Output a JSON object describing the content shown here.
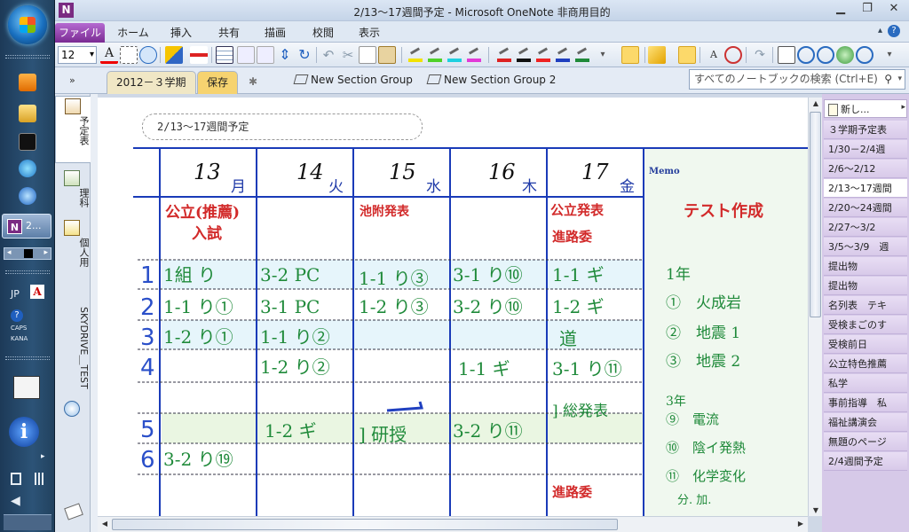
{
  "window": {
    "title": "2/13～17週間予定 - Microsoft OneNote 非商用目的",
    "app_letter": "N"
  },
  "taskbar": {
    "active_label": "2...",
    "lang": "JP",
    "caps": "CAPS",
    "kana": "KANA"
  },
  "ribbon_tabs": [
    "ファイル",
    "ホーム",
    "挿入",
    "共有",
    "描画",
    "校閲",
    "表示"
  ],
  "toolbar": {
    "font_size": "12"
  },
  "sections": {
    "notebook_arrow": "»",
    "tabs": [
      {
        "label": "2012－３学期"
      },
      {
        "label": "保存"
      }
    ],
    "groups": [
      "New Section Group",
      "New Section Group 2"
    ],
    "search_placeholder": "すべてのノートブックの検索 (Ctrl+E)"
  },
  "notebooks": [
    "予定表",
    "理科",
    "個人用",
    "SKYDRIVE＿TEST"
  ],
  "page": {
    "title": "2/13～17週間予定",
    "days": [
      {
        "num": "13",
        "name": "月"
      },
      {
        "num": "14",
        "name": "火"
      },
      {
        "num": "15",
        "name": "水"
      },
      {
        "num": "16",
        "name": "木"
      },
      {
        "num": "17",
        "name": "金"
      }
    ],
    "memo_label": "Memo",
    "row_numbers": [
      "1",
      "2",
      "3",
      "4",
      "5",
      "6"
    ],
    "events": {
      "mon": [
        "公立(推薦)",
        "入試"
      ],
      "wed": "池附発表",
      "fri": [
        "公立発表",
        "進路委"
      ]
    },
    "cells": {
      "mon": [
        "1組 り",
        "1-1 り①",
        "1-2 り①",
        "",
        "",
        "3-2 り⑲"
      ],
      "tue": [
        "3-2 PC",
        "3-1 PC",
        "1-1 り②",
        "1-2 り②",
        "1-2 ギ",
        ""
      ],
      "wed": [
        "1-1 り③",
        "1-2 り③",
        "",
        "",
        "] 研授",
        ""
      ],
      "thu": [
        "3-1 り⑩",
        "3-2 り⑩",
        "",
        "1-1 ギ",
        "3-2 り⑪",
        ""
      ],
      "fri": [
        "1-1 ギ",
        "1-2 ギ",
        "道",
        "3-1 り⑪",
        "] 総発表",
        ""
      ]
    },
    "bottom_note": "進路委",
    "memo": {
      "heading": "テスト作成",
      "lines": [
        "1年",
        "①　火成岩",
        "②　地震 1",
        "③　地震 2",
        "3年",
        "⑨　電流",
        "⑩　陰イ発熱",
        "⑪　化学変化",
        "　分. 加."
      ]
    }
  },
  "pagelist": {
    "new_label": "新し...",
    "items": [
      "３学期予定表",
      "1/30－2/4週",
      "2/6～2/12",
      "2/13～17週間",
      "2/20～24週間",
      "2/27～3/2",
      "3/5～3/9　週",
      "提出物",
      "提出物",
      "名列表　テキ",
      "受検まごのす",
      "受検前日",
      "公立特色推薦",
      "私学",
      "事前指導　私",
      "福祉講演会",
      "無題のページ",
      "2/4週間予定"
    ]
  },
  "colors": {
    "grid_blue": "#1a3bb8",
    "green_ink": "#1f8a3a",
    "red_ink": "#d22a2a",
    "memo_bg": "#f0f8ef",
    "highlight_blue": "#e6f5fb",
    "highlight_green": "#eaf6e2",
    "file_tab": "#8a3aa6"
  }
}
